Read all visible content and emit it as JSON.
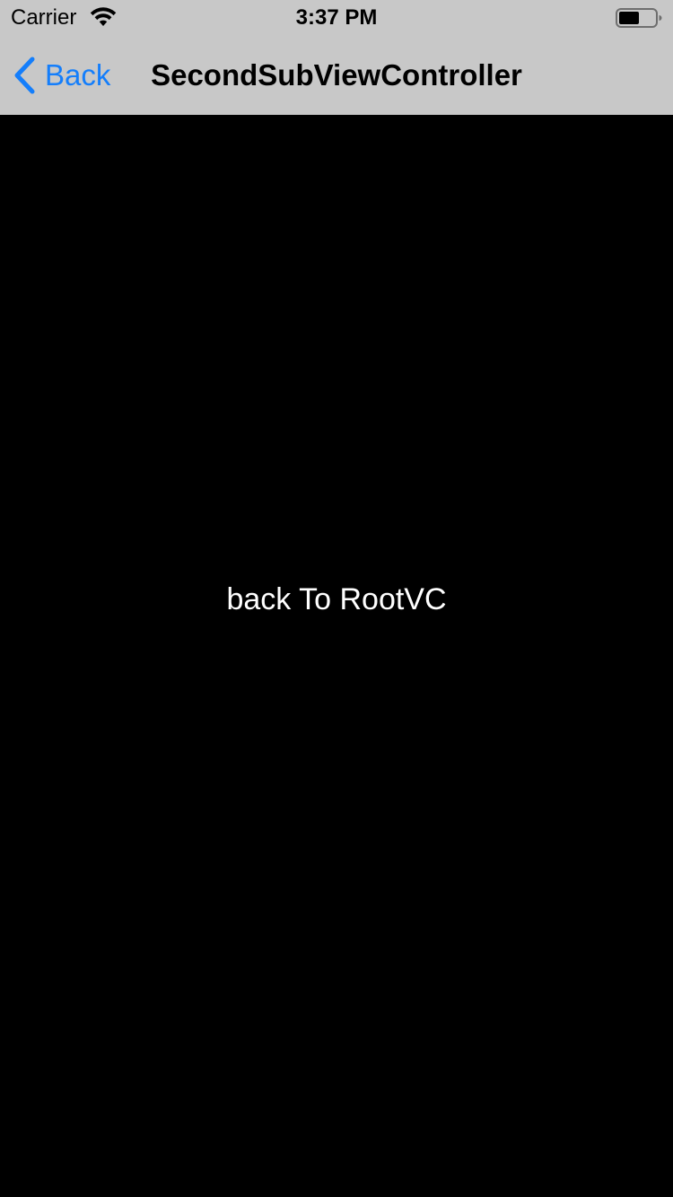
{
  "status_bar": {
    "carrier": "Carrier",
    "time": "3:37 PM",
    "wifi_icon": "wifi-icon",
    "battery_icon": "battery-icon"
  },
  "nav_bar": {
    "back_label": "Back",
    "back_icon": "chevron-left-icon",
    "title": "SecondSubViewController"
  },
  "main": {
    "button_label": "back To RootVC"
  },
  "colors": {
    "nav_background": "#c8c8c8",
    "content_background": "#000000",
    "tint": "#147efb",
    "button_text": "#ffffff"
  }
}
